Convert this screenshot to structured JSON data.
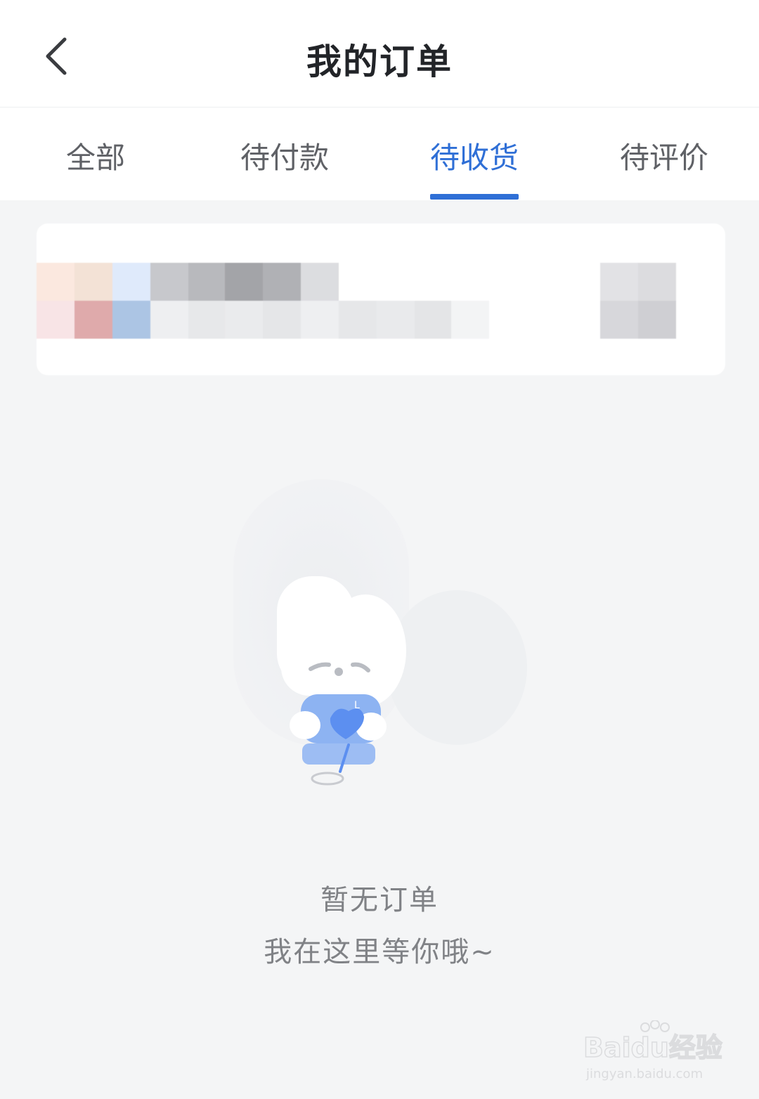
{
  "header": {
    "title": "我的订单"
  },
  "tabs": [
    {
      "label": "全部",
      "active": false
    },
    {
      "label": "待付款",
      "active": false
    },
    {
      "label": "待收货",
      "active": true
    },
    {
      "label": "待评价",
      "active": false
    }
  ],
  "empty_state": {
    "title": "暂无订单",
    "subtitle": "我在这里等你哦~"
  },
  "watermark": {
    "brand": "Baidu经验",
    "url": "jingyan.baidu.com"
  },
  "colors": {
    "accent": "#2f6fd6",
    "background": "#f4f5f6"
  },
  "icons": {
    "back": "chevron-left-icon"
  }
}
